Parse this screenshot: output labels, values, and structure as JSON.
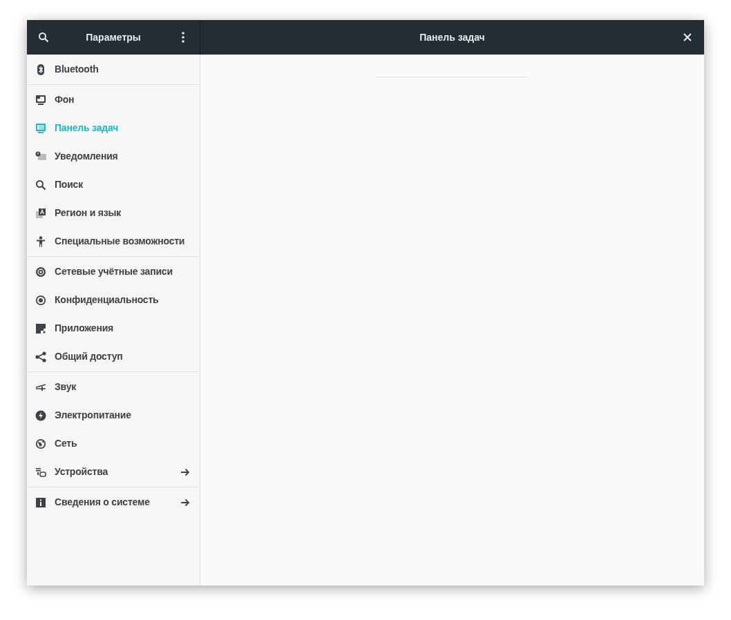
{
  "window": {
    "sidebar_title": "Параметры",
    "title": "Панель задач"
  },
  "sidebar": {
    "groups": [
      {
        "items": [
          {
            "label": "Bluetooth",
            "selected": false,
            "submenu": false
          }
        ]
      },
      {
        "items": [
          {
            "label": "Фон",
            "selected": false,
            "submenu": false
          },
          {
            "label": "Панель задач",
            "selected": true,
            "submenu": false
          },
          {
            "label": "Уведомления",
            "selected": false,
            "submenu": false
          },
          {
            "label": "Поиск",
            "selected": false,
            "submenu": false
          },
          {
            "label": "Регион и язык",
            "selected": false,
            "submenu": false
          },
          {
            "label": "Специальные возможности",
            "selected": false,
            "submenu": false
          }
        ]
      },
      {
        "items": [
          {
            "label": "Сетевые учётные записи",
            "selected": false,
            "submenu": false
          },
          {
            "label": "Конфиденциальность",
            "selected": false,
            "submenu": false
          },
          {
            "label": "Приложения",
            "selected": false,
            "submenu": false
          },
          {
            "label": "Общий доступ",
            "selected": false,
            "submenu": false
          }
        ]
      },
      {
        "items": [
          {
            "label": "Звук",
            "selected": false,
            "submenu": false
          },
          {
            "label": "Электропитание",
            "selected": false,
            "submenu": false
          },
          {
            "label": "Сеть",
            "selected": false,
            "submenu": false
          },
          {
            "label": "Устройства",
            "selected": false,
            "submenu": true
          }
        ]
      },
      {
        "items": [
          {
            "label": "Сведения о системе",
            "selected": false,
            "submenu": true
          }
        ]
      }
    ]
  }
}
